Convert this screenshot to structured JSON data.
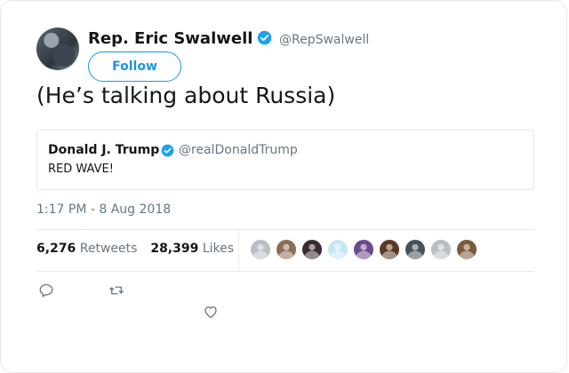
{
  "tweet": {
    "author_name": "Rep. Eric Swalwell",
    "author_handle": "@RepSwalwell",
    "follow_label": "Follow",
    "text": "(He’s talking about Russia)",
    "timestamp": "1:17 PM - 8 Aug 2018"
  },
  "quoted_tweet": {
    "author_name": "Donald J. Trump",
    "author_handle": "@realDonaldTrump",
    "text": "RED WAVE!"
  },
  "stats": {
    "retweets_count": "6,276",
    "retweets_label": "Retweets",
    "likes_count": "28,399",
    "likes_label": "Likes"
  },
  "likers": [
    {
      "icon": "default-avatar-icon",
      "color": "#b7c0c7"
    },
    {
      "icon": "user-avatar-icon",
      "color": "#8a6d5a"
    },
    {
      "icon": "user-avatar-icon",
      "color": "#3a2a33"
    },
    {
      "icon": "egg-avatar-icon",
      "color": "#c6e6f5"
    },
    {
      "icon": "user-avatar-icon",
      "color": "#6b4a8c"
    },
    {
      "icon": "user-avatar-icon",
      "color": "#5a3a22"
    },
    {
      "icon": "user-avatar-icon",
      "color": "#44525e"
    },
    {
      "icon": "default-avatar-icon",
      "color": "#b7c0c7"
    },
    {
      "icon": "user-avatar-icon",
      "color": "#7a5a3a"
    }
  ],
  "colors": {
    "accent": "#1b95e0",
    "secondary_text": "#657786",
    "border": "#e1e8ed"
  }
}
